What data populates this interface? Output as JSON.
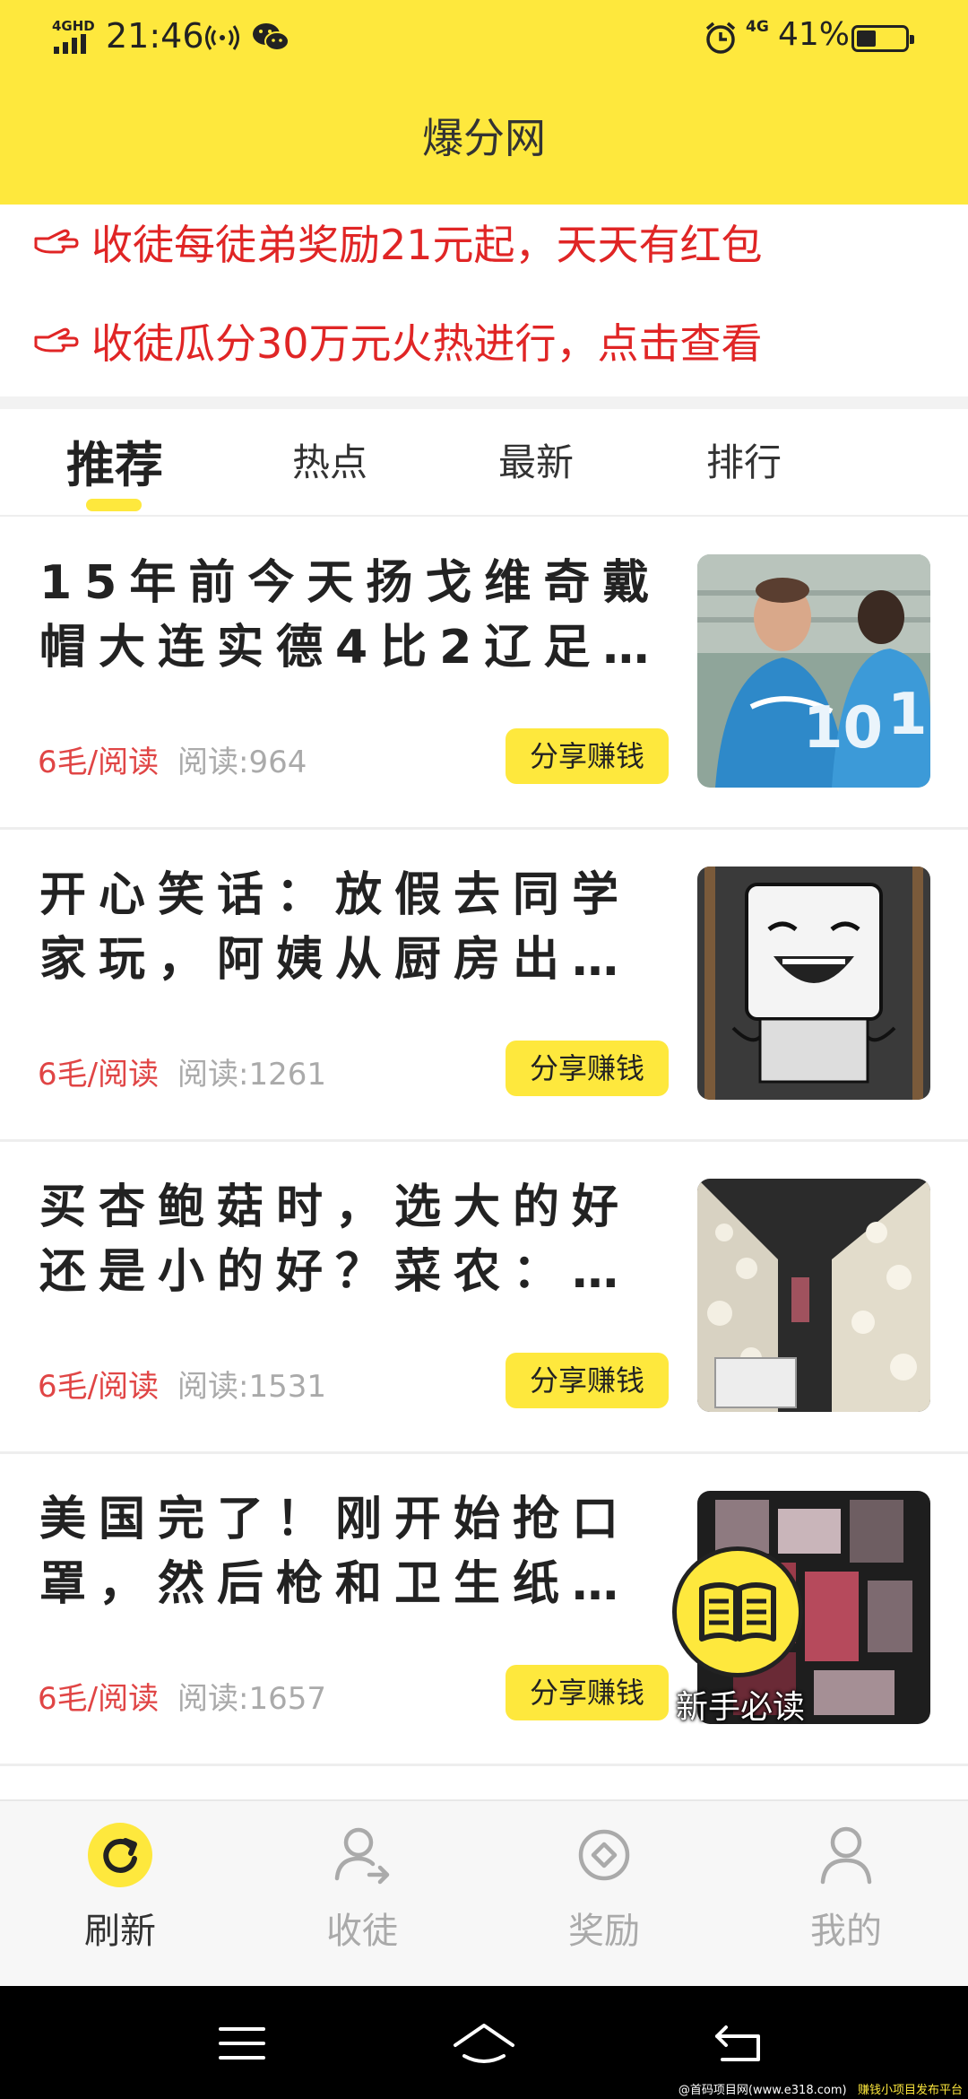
{
  "status_bar": {
    "network": "4GHD",
    "time": "21:46",
    "network2": "4G",
    "battery": "41%",
    "battery_level": 0.41
  },
  "header": {
    "title": "爆分网"
  },
  "notices": [
    "收徒每徒弟奖励21元起，天天有红包",
    "收徒瓜分30万元火热进行，点击查看"
  ],
  "tabs": [
    {
      "label": "推荐",
      "active": true
    },
    {
      "label": "热点",
      "active": false
    },
    {
      "label": "最新",
      "active": false
    },
    {
      "label": "排行",
      "active": false
    }
  ],
  "articles": [
    {
      "title": "15年前今天扬戈维奇戴帽大连实德4比2辽足…",
      "rate": "6毛/阅读",
      "reads": "阅读:964",
      "share": "分享赚钱",
      "image": "football-celebration"
    },
    {
      "title": "开心笑话：放假去同学家玩，阿姨从厨房出…",
      "rate": "6毛/阅读",
      "reads": "阅读:1261",
      "share": "分享赚钱",
      "image": "meme-face"
    },
    {
      "title": "买杏鲍菇时，选大的好还是小的好？菜农：…",
      "rate": "6毛/阅读",
      "reads": "阅读:1531",
      "share": "分享赚钱",
      "image": "mushroom-farm"
    },
    {
      "title": "美国完了！刚开始抢口罩，然后枪和卫生纸…",
      "rate": "6毛/阅读",
      "reads": "阅读:1657",
      "share": "分享赚钱",
      "image": "blurred-store"
    }
  ],
  "floating_guide": {
    "label": "新手必读",
    "icon": "book-icon"
  },
  "bottom_nav": [
    {
      "label": "刷新",
      "icon": "refresh-icon",
      "active": true
    },
    {
      "label": "收徒",
      "icon": "add-user-icon",
      "active": false
    },
    {
      "label": "奖励",
      "icon": "reward-icon",
      "active": false
    },
    {
      "label": "我的",
      "icon": "profile-icon",
      "active": false
    }
  ],
  "watermark": {
    "left": "@首码项目网(www.e318.com)",
    "right": "赚钱小项目发布平台"
  },
  "colors": {
    "accent": "#FEE83D",
    "notice_red": "#E02525",
    "rate_red": "#E04545",
    "muted": "#AAAAAA"
  }
}
